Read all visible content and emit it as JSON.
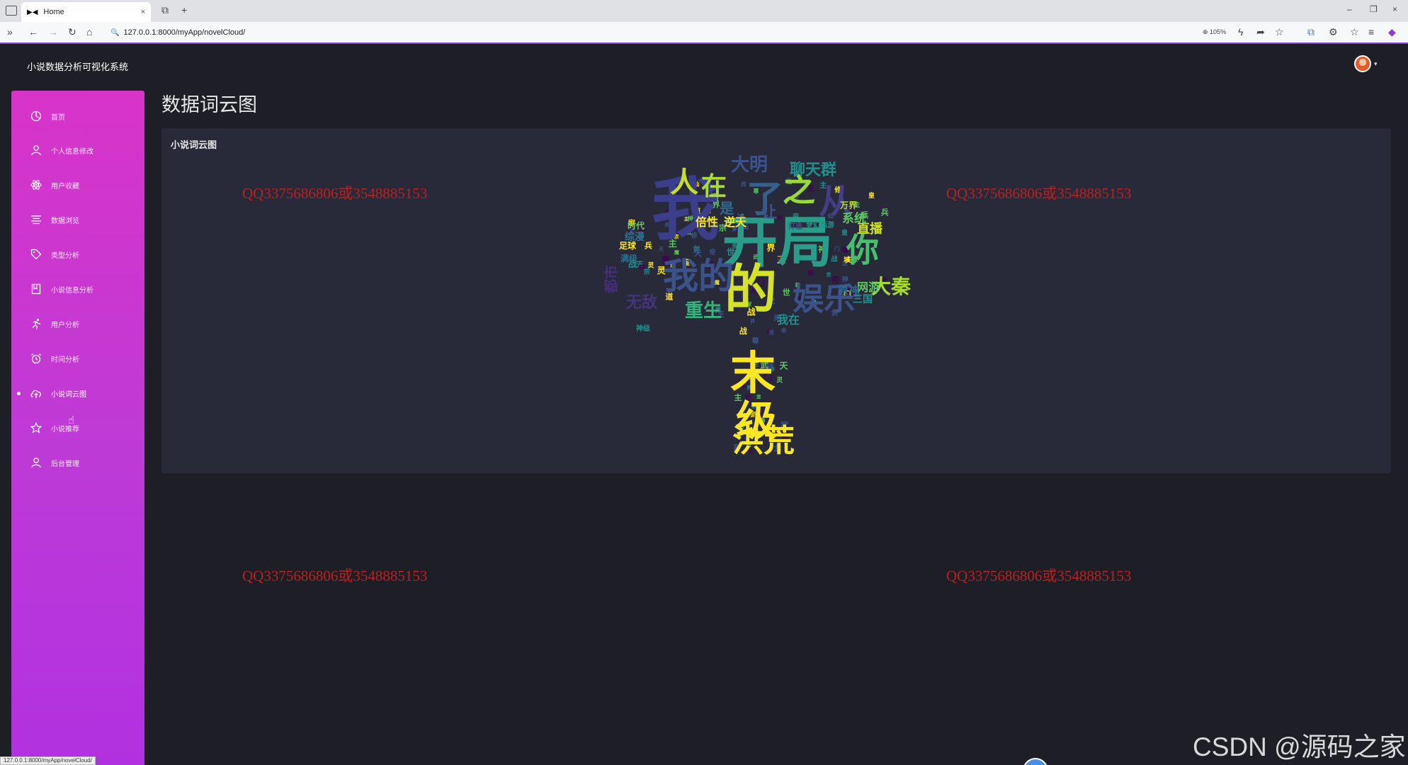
{
  "browser": {
    "tab_title": "Home",
    "tab_close": "×",
    "new_tab": "+",
    "url": "127.0.0.1:8000/myApp/novelCloud/",
    "zoom": "105%",
    "status_url": "127.0.0.1:8000/myApp/novelCloud/",
    "win_min": "–",
    "win_max": "❐",
    "win_close": "×"
  },
  "header": {
    "app_title": "小说数据分析可视化系统"
  },
  "sidebar": {
    "items": [
      {
        "label": "首页",
        "icon": "dashboard-icon"
      },
      {
        "label": "个人信息修改",
        "icon": "user-icon"
      },
      {
        "label": "用户收藏",
        "icon": "atom-icon"
      },
      {
        "label": "数据浏览",
        "icon": "list-icon"
      },
      {
        "label": "类型分析",
        "icon": "tag-icon"
      },
      {
        "label": "小说信息分析",
        "icon": "book-icon"
      },
      {
        "label": "用户分析",
        "icon": "runner-icon"
      },
      {
        "label": "时间分析",
        "icon": "alarm-icon"
      },
      {
        "label": "小说词云图",
        "icon": "cloud-upload-icon"
      },
      {
        "label": "小说推荐",
        "icon": "star-icon"
      },
      {
        "label": "后台管理",
        "icon": "admin-user-icon"
      }
    ],
    "active_index": 8
  },
  "main": {
    "page_title": "数据词云图",
    "card_title": "小说词云图"
  },
  "watermarks": [
    "QQ3375686806或3548885153",
    "QQ3375686806或3548885153",
    "QQ3375686806或3548885153",
    "QQ3375686806或3548885153"
  ],
  "corner_watermark": "CSDN @源码之家",
  "wordcloud": {
    "colors": [
      "#440154",
      "#3b528b",
      "#21908d",
      "#5dc863",
      "#fde725"
    ],
    "words": [
      {
        "text": "开局",
        "color": "#2a9d8a"
      },
      {
        "text": "的",
        "color": "#d6e22a"
      },
      {
        "text": "我",
        "color": "#3b3f8b"
      },
      {
        "text": "我的",
        "color": "#3b528b"
      },
      {
        "text": "了",
        "color": "#35608d"
      },
      {
        "text": "之",
        "color": "#9ad93a"
      },
      {
        "text": "从",
        "color": "#433e85"
      },
      {
        "text": "人",
        "color": "#c7e020"
      },
      {
        "text": "在",
        "color": "#a8db34"
      },
      {
        "text": "你",
        "color": "#46c06f"
      },
      {
        "text": "娱乐",
        "color": "#3b528b"
      },
      {
        "text": "重生",
        "color": "#31b57b"
      },
      {
        "text": "大秦",
        "color": "#a8db34"
      },
      {
        "text": "大明",
        "color": "#3b528b"
      },
      {
        "text": "聊天群",
        "color": "#21908d"
      },
      {
        "text": "直播",
        "color": "#d2e21b"
      },
      {
        "text": "系统",
        "color": "#5dc863"
      },
      {
        "text": "网游",
        "color": "#5dc863"
      },
      {
        "text": "逆天",
        "color": "#fde725"
      },
      {
        "text": "倍性",
        "color": "#fde725"
      },
      {
        "text": "原神",
        "color": "#31688e"
      },
      {
        "text": "三国",
        "color": "#21908d"
      },
      {
        "text": "时代",
        "color": "#6ece58"
      },
      {
        "text": "足球",
        "color": "#fde725"
      },
      {
        "text": "综漫",
        "color": "#2c728e"
      },
      {
        "text": "让",
        "color": "#3b528b"
      },
      {
        "text": "是",
        "color": "#31688e"
      },
      {
        "text": "我在",
        "color": "#21908d"
      },
      {
        "text": "洪荒",
        "color": "#fde725"
      },
      {
        "text": "末",
        "color": "#fde725"
      },
      {
        "text": "级",
        "color": "#fde725"
      },
      {
        "text": "无敌",
        "color": "#46337e"
      },
      {
        "text": "都市",
        "color": "#472d7b"
      },
      {
        "text": "万界",
        "color": "#b5de2b"
      },
      {
        "text": "梦幻西游",
        "color": "#21908d"
      },
      {
        "text": "打造",
        "color": "#3b528b"
      },
      {
        "text": "神级",
        "color": "#21908d"
      },
      {
        "text": "满级",
        "color": "#2c728e"
      }
    ]
  }
}
